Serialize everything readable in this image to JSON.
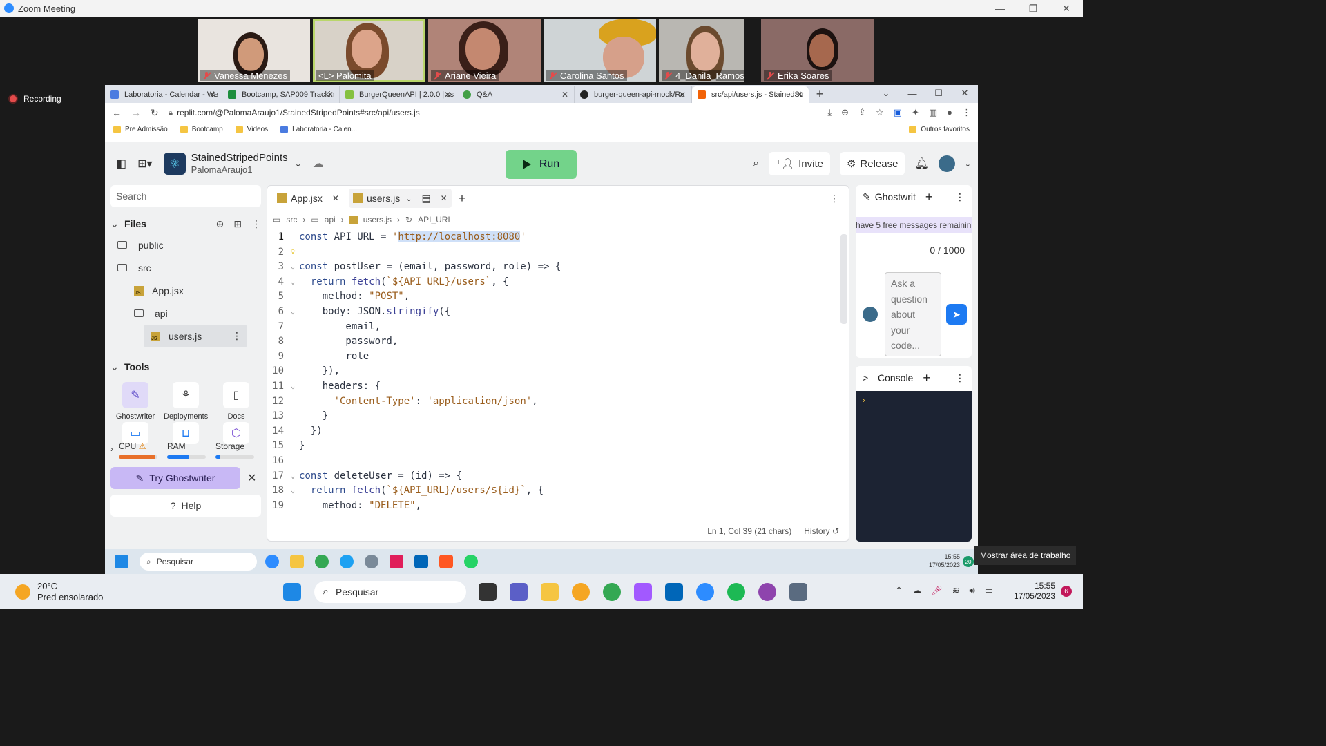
{
  "zoom": {
    "window_title": "Zoom Meeting",
    "recording_label": "Recording",
    "participants": [
      {
        "name": "Vanessa Menezes"
      },
      {
        "name": "<L> Palomita"
      },
      {
        "name": "Ariane Vieira"
      },
      {
        "name": "Carolina Santos"
      },
      {
        "name": "4_Danila_Ramos"
      },
      {
        "name": "Erika Soares"
      }
    ]
  },
  "browser": {
    "tabs": [
      {
        "label": "Laboratoria - Calendar - We"
      },
      {
        "label": "Bootcamp, SAP009 Trackin"
      },
      {
        "label": "BurgerQueenAPI | 2.0.0 | ss"
      },
      {
        "label": "Q&A"
      },
      {
        "label": "burger-queen-api-mock/Re"
      },
      {
        "label": "src/api/users.js - StainedStr"
      }
    ],
    "url": "replit.com/@PalomaAraujo1/StainedStripedPoints#src/api/users.js",
    "bookmarks": [
      "Pre Admissão",
      "Bootcamp",
      "Videos",
      "Laboratoria - Calen..."
    ],
    "other_bookmarks": "Outros favoritos"
  },
  "replit": {
    "repl_name": "StainedStripedPoints",
    "owner": "PalomaAraujo1",
    "run_label": "Run",
    "invite_label": "Invite",
    "release_label": "Release",
    "search_placeholder": "Search",
    "files_label": "Files",
    "files": [
      {
        "name": "public",
        "kind": "folder"
      },
      {
        "name": "src",
        "kind": "folder"
      },
      {
        "name": "App.jsx",
        "kind": "file"
      },
      {
        "name": "api",
        "kind": "folder"
      },
      {
        "name": "users.js",
        "kind": "file"
      }
    ],
    "tools_label": "Tools",
    "tools": [
      {
        "label": "Ghostwriter"
      },
      {
        "label": "Deployments"
      },
      {
        "label": "Docs"
      }
    ],
    "resources": {
      "cpu": "CPU",
      "ram": "RAM",
      "storage": "Storage",
      "cpu_level": 0.95,
      "ram_level": 0.55,
      "storage_level": 0.1
    },
    "try_ghostwriter": "Try Ghostwriter",
    "help": "Help",
    "editor_tabs": [
      {
        "label": "App.jsx"
      },
      {
        "label": "users.js"
      }
    ],
    "breadcrumb": [
      "src",
      "api",
      "users.js",
      "API_URL"
    ],
    "code_lines": [
      "const API_URL = 'http://localhost:8080'",
      "",
      "const postUser = (email, password, role) => {",
      "  return fetch(`${API_URL}/users`, {",
      "    method: \"POST\",",
      "    body: JSON.stringify({",
      "        email,",
      "        password,",
      "        role",
      "    }),",
      "    headers: {",
      "      'Content-Type': 'application/json',",
      "    }",
      "  })",
      "}",
      "",
      "const deleteUser = (id) => {",
      "  return fetch(`${API_URL}/users/${id}`, {",
      "    method: \"DELETE\","
    ],
    "status": "Ln 1, Col 39 (21 chars)",
    "history": "History",
    "ghostwriter": {
      "title": "Ghostwrit",
      "warning": "have 5 free messages remainin",
      "count": "0 / 1000",
      "placeholder": "Ask a question about your code..."
    },
    "console": {
      "title": "Console",
      "prompt": "›"
    }
  },
  "remote_taskbar": {
    "search": "Pesquisar",
    "time": "15:55",
    "date": "17/05/2023",
    "badge": "20",
    "tooltip": "Mostrar área de trabalho"
  },
  "os_taskbar": {
    "temperature": "20°C",
    "weather": "Pred ensolarado",
    "search": "Pesquisar",
    "time": "15:55",
    "date": "17/05/2023",
    "badge": "6"
  }
}
